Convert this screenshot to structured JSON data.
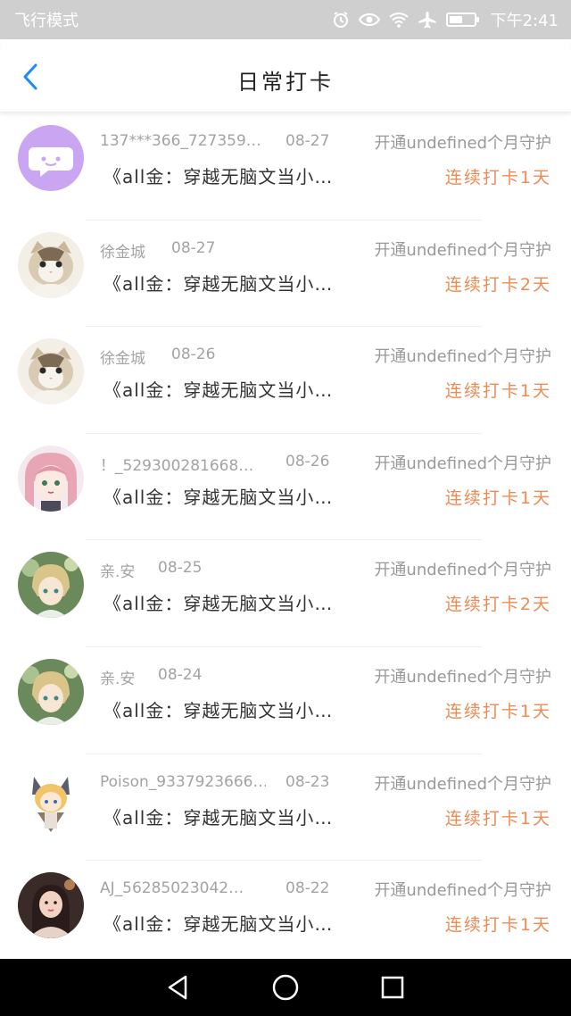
{
  "status": {
    "mode": "飞行模式",
    "time": "下午2:41",
    "battery_level": 0.55
  },
  "header": {
    "title": "日常打卡"
  },
  "rows": [
    {
      "name": "137***366_727359…",
      "date": "08-27",
      "guard": "开通undefined个月守护",
      "book": "《all金：穿越无脑文当小…",
      "streak": "连续打卡1天",
      "avatar": "chat-bubble"
    },
    {
      "name": "徐金城",
      "date": "08-27",
      "guard": "开通undefined个月守护",
      "book": "《all金：穿越无脑文当小…",
      "streak": "连续打卡2天",
      "avatar": "kitten"
    },
    {
      "name": "徐金城",
      "date": "08-26",
      "guard": "开通undefined个月守护",
      "book": "《all金：穿越无脑文当小…",
      "streak": "连续打卡1天",
      "avatar": "kitten"
    },
    {
      "name": "！_529300281668…",
      "date": "08-26",
      "guard": "开通undefined个月守护",
      "book": "《all金：穿越无脑文当小…",
      "streak": "连续打卡1天",
      "avatar": "anime-pink"
    },
    {
      "name": "亲.安",
      "date": "08-25",
      "guard": "开通undefined个月守护",
      "book": "《all金：穿越无脑文当小…",
      "streak": "连续打卡2天",
      "avatar": "anime-green"
    },
    {
      "name": "亲.安",
      "date": "08-24",
      "guard": "开通undefined个月守护",
      "book": "《all金：穿越无脑文当小…",
      "streak": "连续打卡1天",
      "avatar": "anime-green"
    },
    {
      "name": "Poison_9337923666…",
      "date": "08-23",
      "guard": "开通undefined个月守护",
      "book": "《all金：穿越无脑文当小…",
      "streak": "连续打卡1天",
      "avatar": "anime-cat"
    },
    {
      "name": "AJ_56285023042…",
      "date": "08-22",
      "guard": "开通undefined个月守护",
      "book": "《all金：穿越无脑文当小…",
      "streak": "连续打卡1天",
      "avatar": "girl-photo"
    }
  ],
  "colors": {
    "accent": "#1a8cff",
    "streak": "#ef8a52",
    "muted": "#a3a3a3"
  },
  "icons": {
    "alarm": "alarm-icon",
    "eye": "eye-comfort-icon",
    "wifi": "wifi-icon",
    "airplane": "airplane-icon",
    "battery": "battery-icon",
    "back": "back-chevron-icon",
    "nav_back": "nav-back-icon",
    "nav_home": "nav-home-icon",
    "nav_recents": "nav-recents-icon"
  }
}
